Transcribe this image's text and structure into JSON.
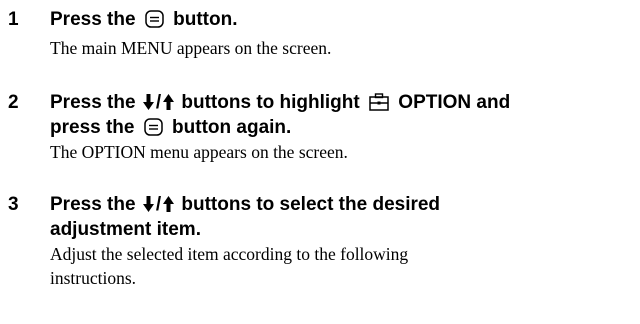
{
  "steps": [
    {
      "number": "1",
      "heading_a": "Press the",
      "heading_b": "button.",
      "text": "The main MENU appears on the screen.",
      "icons": [
        "menu-button-icon"
      ]
    },
    {
      "number": "2",
      "heading_a": "Press the",
      "slash": "/",
      "heading_b": "buttons to highlight",
      "heading_c": "OPTION and",
      "heading_d": "press the",
      "heading_e": "button again.",
      "text": "The OPTION menu appears on the screen.",
      "icons": [
        "down-arrow-icon",
        "up-arrow-icon",
        "option-toolbox-icon",
        "menu-button-icon"
      ]
    },
    {
      "number": "3",
      "heading_a": "Press the",
      "slash": "/",
      "heading_b": "buttons to select the desired",
      "heading_c": "adjustment item.",
      "text_line1": "Adjust the selected item according to the following",
      "text_line2": "instructions.",
      "icons": [
        "down-arrow-icon",
        "up-arrow-icon"
      ]
    }
  ]
}
